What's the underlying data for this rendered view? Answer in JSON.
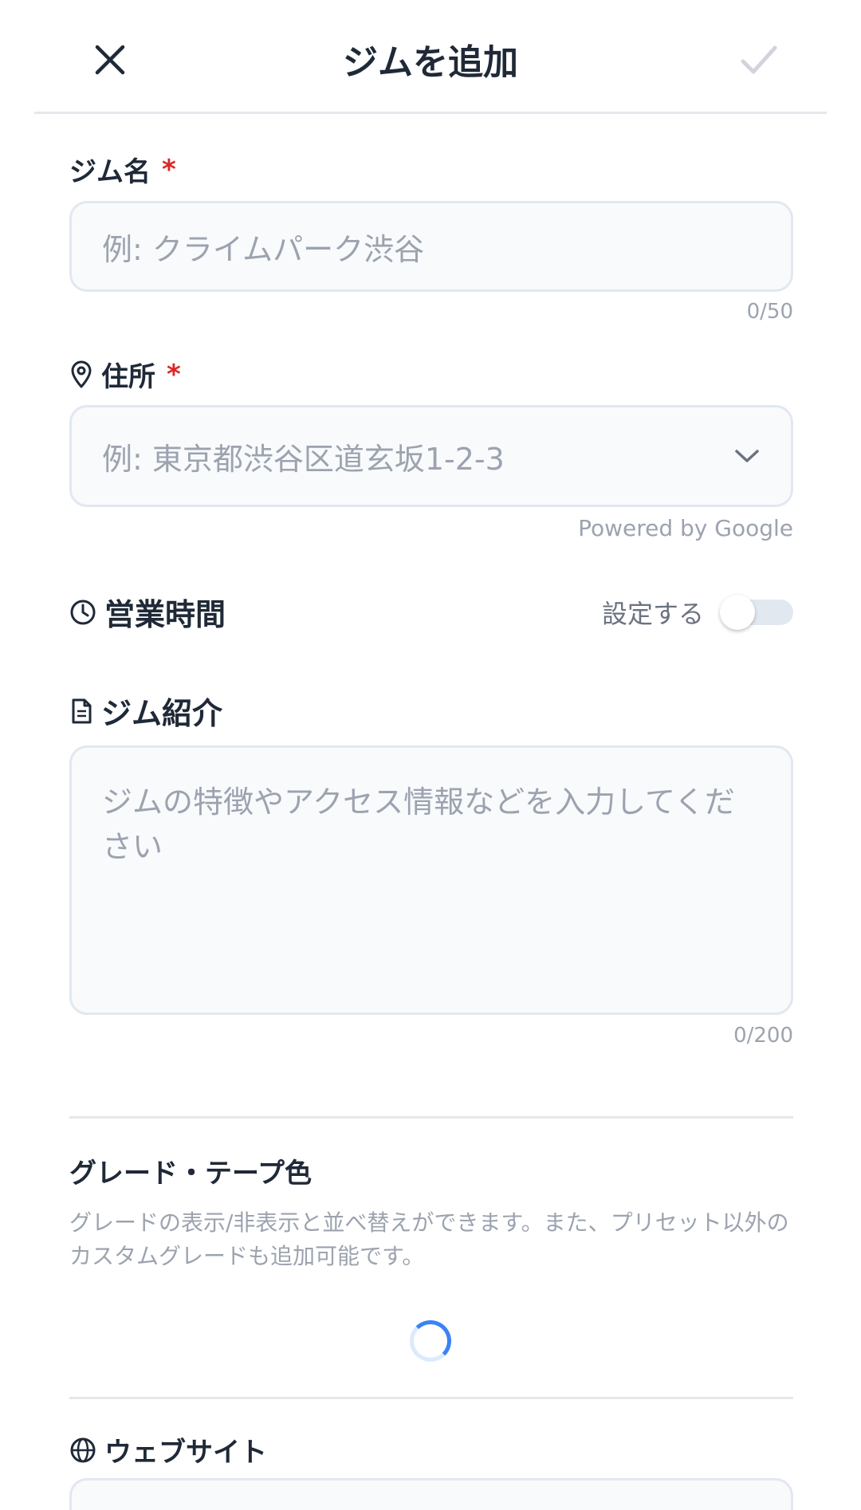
{
  "header": {
    "title": "ジムを追加"
  },
  "gym_name": {
    "label": "ジム名",
    "required_mark": "*",
    "placeholder": "例: クライムパーク渋谷",
    "counter": "0/50"
  },
  "address": {
    "label": "住所",
    "required_mark": "*",
    "placeholder": "例: 東京都渋谷区道玄坂1-2-3",
    "attribution": "Powered by Google"
  },
  "hours": {
    "label": "営業時間",
    "toggle_label": "設定する",
    "toggle_on": false
  },
  "description": {
    "label": "ジム紹介",
    "placeholder": "ジムの特徴やアクセス情報などを入力してください",
    "counter": "0/200"
  },
  "grades": {
    "title": "グレード・テープ色",
    "help_text": "グレードの表示/非表示と並べ替えができます。また、プリセット以外のカスタムグレードも追加可能です。"
  },
  "website": {
    "label": "ウェブサイト"
  },
  "colors": {
    "text": "#1f2937",
    "muted": "#9ca3af",
    "required": "#dc2626",
    "input_bg": "#f8fafc",
    "border": "#e2e8f0",
    "spinner": "#3b82f6"
  },
  "icons": {
    "close": "close-icon",
    "confirm": "check-icon",
    "address": "map-pin-icon",
    "dropdown": "chevron-down-icon",
    "hours": "clock-icon",
    "description": "document-icon",
    "website": "globe-icon",
    "loading": "loading-spinner"
  }
}
